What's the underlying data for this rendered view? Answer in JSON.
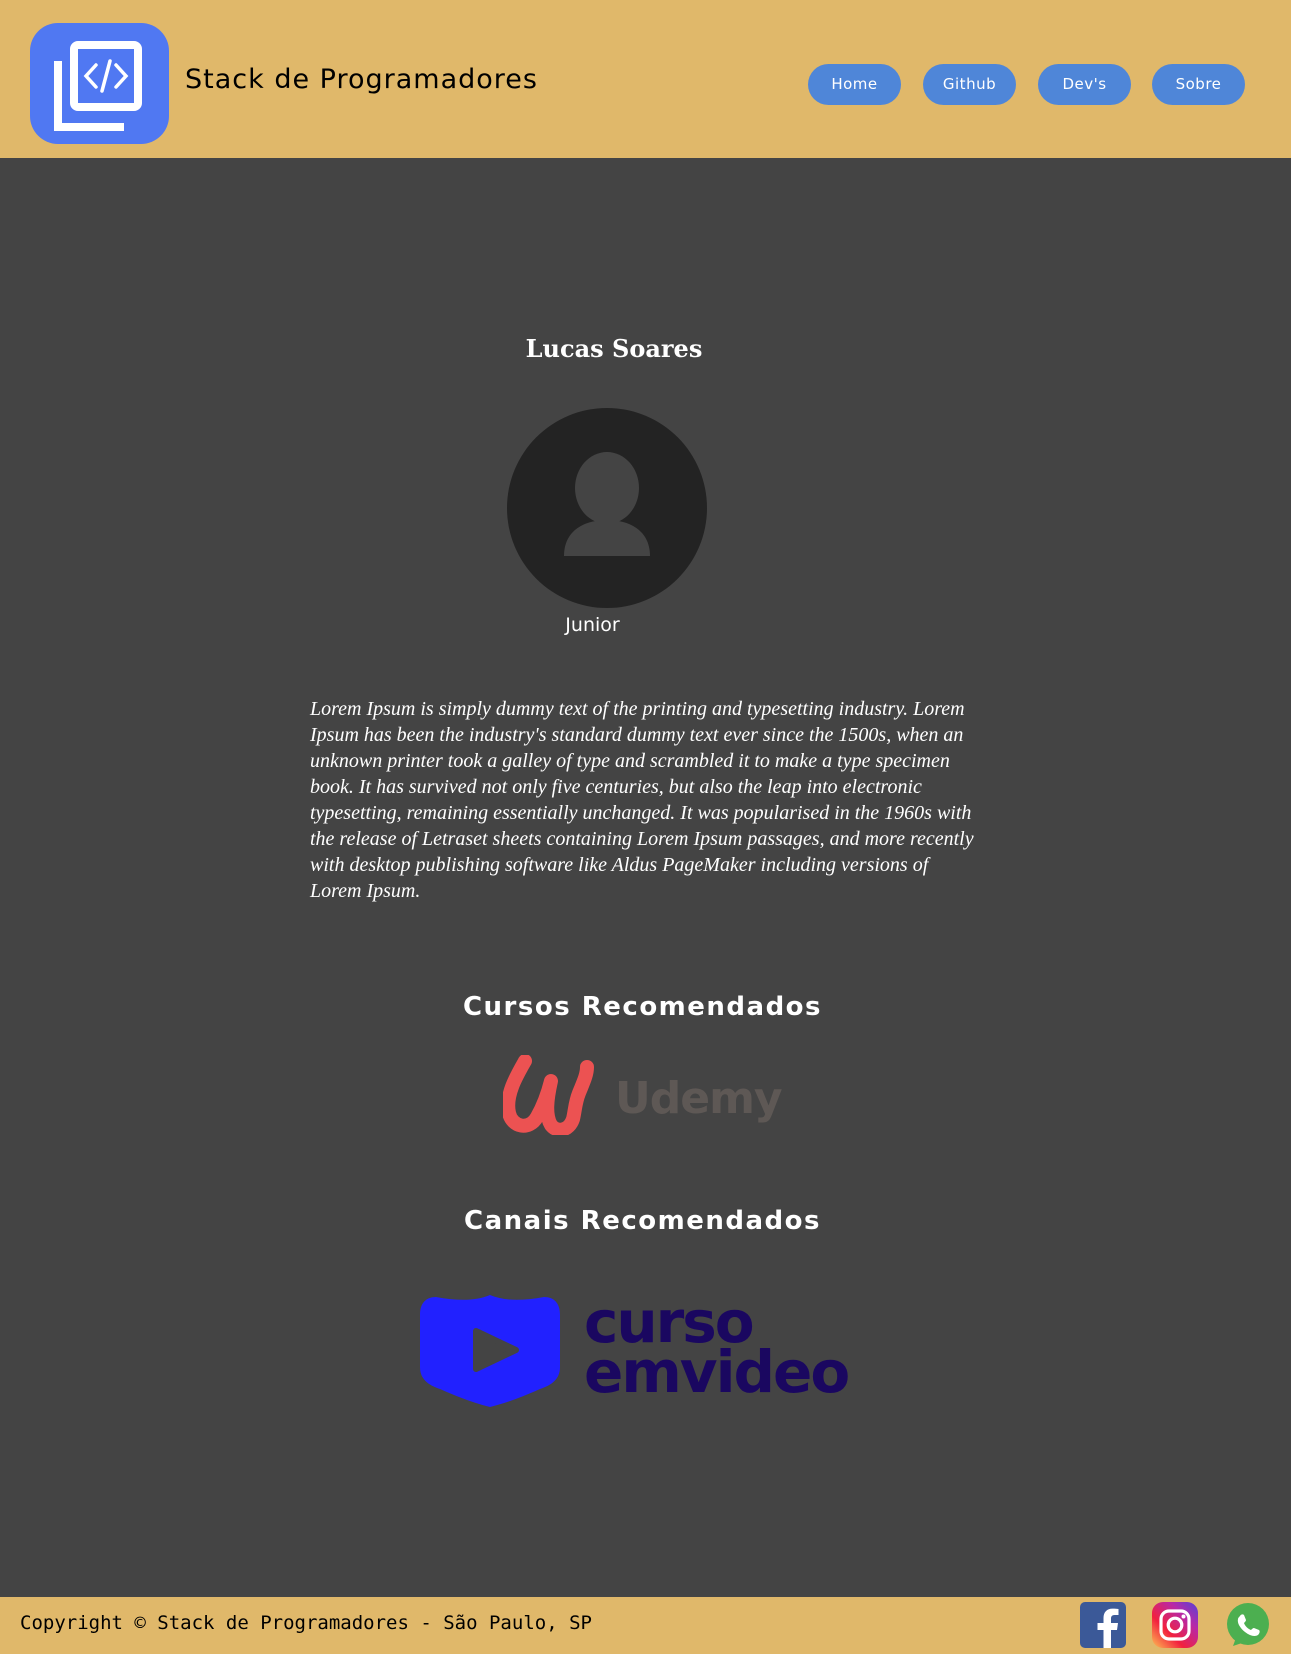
{
  "header": {
    "logo_icon": "code-window-icon",
    "title": "Stack de Programadores",
    "nav": [
      {
        "label": "Home"
      },
      {
        "label": "Github"
      },
      {
        "label": "Dev's"
      },
      {
        "label": "Sobre"
      }
    ]
  },
  "profile": {
    "name": "Lucas Soares",
    "avatar_icon": "user-silhouette-icon",
    "level": "Junior",
    "bio": "Lorem Ipsum is simply dummy text of the printing and typesetting industry. Lorem Ipsum has been the industry's standard dummy text ever since the 1500s, when an unknown printer took a galley of type and scrambled it to make a type specimen book. It has survived not only five centuries, but also the leap into electronic typesetting, remaining essentially unchanged. It was popularised in the 1960s with the release of Letraset sheets containing Lorem Ipsum passages, and more recently with desktop publishing software like Aldus PageMaker including versions of Lorem Ipsum."
  },
  "courses": {
    "heading": "Cursos Recomendados",
    "logo_wordmark": "Udemy"
  },
  "channels": {
    "heading": "Canais Recomendados",
    "logo_line1": "curso",
    "logo_line2": "emvideo"
  },
  "footer": {
    "copyright": "Copyright © Stack de Programadores - São Paulo, SP",
    "social": [
      "facebook-icon",
      "instagram-icon",
      "whatsapp-icon"
    ]
  },
  "colors": {
    "header_bg": "#E0B86A",
    "page_bg": "#444444",
    "nav_button": "#4F86D8",
    "logo_bg": "#5078F2",
    "udemy_red": "#EC5252",
    "cursoemvideo_blue": "#2121FF",
    "cursoemvideo_text": "#1A0760"
  }
}
